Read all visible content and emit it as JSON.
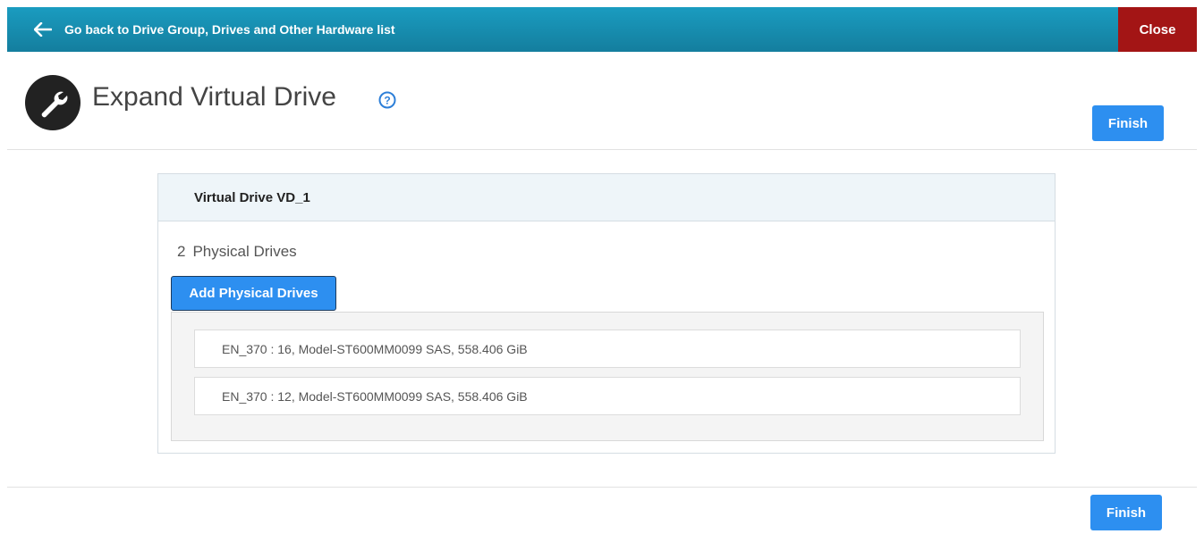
{
  "topbar": {
    "back_label": "Go back to Drive Group, Drives and Other Hardware list",
    "close_label": "Close",
    "back_icon": "arrow-left-icon"
  },
  "header": {
    "title": "Expand Virtual Drive",
    "icon": "wrench-icon",
    "help_icon": "question-circle-icon",
    "finish_label": "Finish"
  },
  "card": {
    "title": "Virtual Drive VD_1",
    "drive_count": "2",
    "drive_count_label": "Physical Drives",
    "add_button_label": "Add Physical Drives",
    "drives": [
      {
        "label": "EN_370 : 16, Model-ST600MM0099 SAS, 558.406 GiB"
      },
      {
        "label": "EN_370 : 12, Model-ST600MM0099 SAS, 558.406 GiB"
      }
    ]
  },
  "footer": {
    "finish_label": "Finish"
  },
  "colors": {
    "topbar": "#1a9cc0",
    "close": "#a31515",
    "primary_button": "#2d8ff0"
  }
}
